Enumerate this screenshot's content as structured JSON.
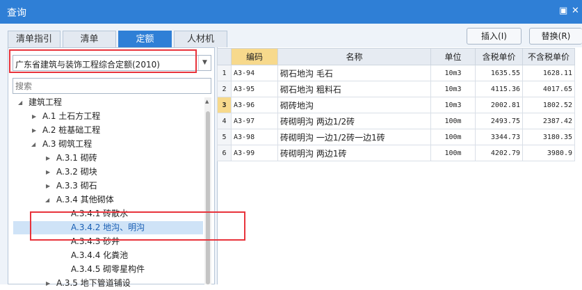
{
  "window": {
    "title": "查询",
    "restore_glyph": "▣",
    "close_glyph": "✕"
  },
  "tabs": [
    {
      "label": "清单指引",
      "active": false
    },
    {
      "label": "清单",
      "active": false
    },
    {
      "label": "定额",
      "active": true
    },
    {
      "label": "人材机",
      "active": false
    }
  ],
  "buttons": {
    "insert": "插入(I)",
    "replace": "替换(R)"
  },
  "quota_library": {
    "selected": "广东省建筑与装饰工程综合定额(2010)"
  },
  "search": {
    "placeholder": "搜索"
  },
  "tree": [
    {
      "label": "建筑工程",
      "expanded": true,
      "selected": false
    },
    {
      "label": "A.1 土石方工程",
      "expanded": false,
      "selected": false
    },
    {
      "label": "A.2 桩基础工程",
      "expanded": false,
      "selected": false
    },
    {
      "label": "A.3 砌筑工程",
      "expanded": true,
      "selected": false
    },
    {
      "label": "A.3.1 砌砖",
      "expanded": false,
      "selected": false
    },
    {
      "label": "A.3.2 砌块",
      "expanded": false,
      "selected": false
    },
    {
      "label": "A.3.3 砌石",
      "expanded": false,
      "selected": false
    },
    {
      "label": "A.3.4 其他砌体",
      "expanded": true,
      "selected": false
    },
    {
      "label": "A.3.4.1 砖散水",
      "selected": false
    },
    {
      "label": "A.3.4.2 地沟、明沟",
      "selected": true
    },
    {
      "label": "A.3.4.3 砂井",
      "selected": false
    },
    {
      "label": "A.3.4.4 化粪池",
      "selected": false
    },
    {
      "label": "A.3.4.5 砌零星构件",
      "selected": false
    },
    {
      "label": "A.3.5 地下管道铺设",
      "expanded": false,
      "selected": false
    }
  ],
  "table": {
    "columns": [
      "",
      "编码",
      "名称",
      "单位",
      "含税单价",
      "不含税单价"
    ],
    "rows": [
      {
        "idx": "1",
        "code": "A3-94",
        "name": "砌石地沟 毛石",
        "unit": "10m3",
        "price_tax": "1635.55",
        "price_notax": "1628.11",
        "current": false
      },
      {
        "idx": "2",
        "code": "A3-95",
        "name": "砌石地沟 粗料石",
        "unit": "10m3",
        "price_tax": "4115.36",
        "price_notax": "4017.65",
        "current": false
      },
      {
        "idx": "3",
        "code": "A3-96",
        "name": "砌砖地沟",
        "unit": "10m3",
        "price_tax": "2002.81",
        "price_notax": "1802.52",
        "current": true
      },
      {
        "idx": "4",
        "code": "A3-97",
        "name": "砖砌明沟 两边1/2砖",
        "unit": "100m",
        "price_tax": "2493.75",
        "price_notax": "2387.42",
        "current": false
      },
      {
        "idx": "5",
        "code": "A3-98",
        "name": "砖砌明沟 一边1/2砖一边1砖",
        "unit": "100m",
        "price_tax": "3344.73",
        "price_notax": "3180.35",
        "current": false
      },
      {
        "idx": "6",
        "code": "A3-99",
        "name": "砖砌明沟 两边1砖",
        "unit": "100m",
        "price_tax": "4202.79",
        "price_notax": "3980.9",
        "current": false
      }
    ]
  },
  "colors": {
    "accent": "#2f7fd6",
    "highlight_col": "#f7d98c",
    "selected_row": "#cfe3f7",
    "annotation": "#e8333b"
  }
}
